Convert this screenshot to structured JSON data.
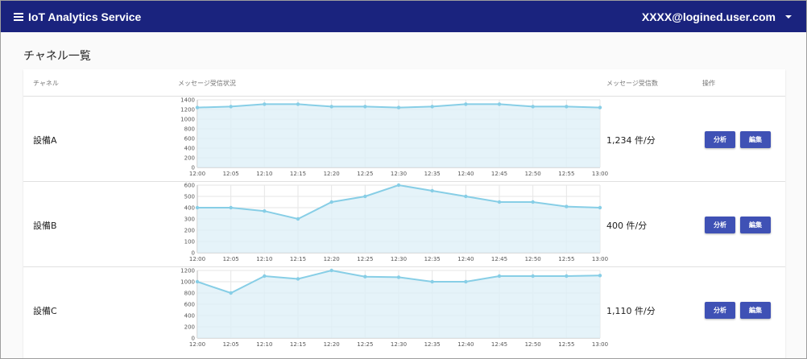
{
  "appbar": {
    "title": "IoT Analytics Service",
    "user_email": "XXXX@logined.user.com"
  },
  "page_title": "チャネル一覧",
  "table": {
    "columns": {
      "channel": "チャネル",
      "status": "メッセージ受信状況",
      "count": "メッセージ受信数",
      "actions": "操作"
    },
    "rows": [
      {
        "name": "設備A",
        "rate": "1,234 件/分",
        "analyze_label": "分析",
        "edit_label": "編集"
      },
      {
        "name": "設備B",
        "rate": "400 件/分",
        "analyze_label": "分析",
        "edit_label": "編集"
      },
      {
        "name": "設備C",
        "rate": "1,110 件/分",
        "analyze_label": "分析",
        "edit_label": "編集"
      }
    ]
  },
  "colors": {
    "appbar": "#1a237e",
    "button": "#3f51b5",
    "line": "#87cee6",
    "fill": "#dff0f8"
  },
  "chart_data": [
    {
      "type": "area",
      "x": [
        "12:00",
        "12:05",
        "12:10",
        "12:15",
        "12:20",
        "12:25",
        "12:30",
        "12:35",
        "12:40",
        "12:45",
        "12:50",
        "12:55",
        "13:00"
      ],
      "values": [
        1240,
        1260,
        1310,
        1310,
        1260,
        1260,
        1240,
        1260,
        1310,
        1310,
        1260,
        1260,
        1240
      ],
      "yticks": [
        0,
        200,
        400,
        600,
        800,
        1000,
        1200,
        1400
      ],
      "ylim": [
        0,
        1400
      ],
      "grid": true
    },
    {
      "type": "area",
      "x": [
        "12:00",
        "12:05",
        "12:10",
        "12:15",
        "12:20",
        "12:25",
        "12:30",
        "12:35",
        "12:40",
        "12:45",
        "12:50",
        "12:55",
        "13:00"
      ],
      "values": [
        400,
        400,
        370,
        300,
        450,
        500,
        600,
        550,
        500,
        450,
        450,
        410,
        400
      ],
      "yticks": [
        0,
        100,
        200,
        300,
        400,
        500,
        600
      ],
      "ylim": [
        0,
        600
      ],
      "grid": true
    },
    {
      "type": "area",
      "x": [
        "12:00",
        "12:05",
        "12:10",
        "12:15",
        "12:20",
        "12:25",
        "12:30",
        "12:35",
        "12:40",
        "12:45",
        "12:50",
        "12:55",
        "13:00"
      ],
      "values": [
        1000,
        800,
        1100,
        1050,
        1200,
        1090,
        1080,
        1000,
        1000,
        1100,
        1100,
        1100,
        1110
      ],
      "yticks": [
        0,
        200,
        400,
        600,
        800,
        1000,
        1200
      ],
      "ylim": [
        0,
        1200
      ],
      "grid": true
    }
  ]
}
